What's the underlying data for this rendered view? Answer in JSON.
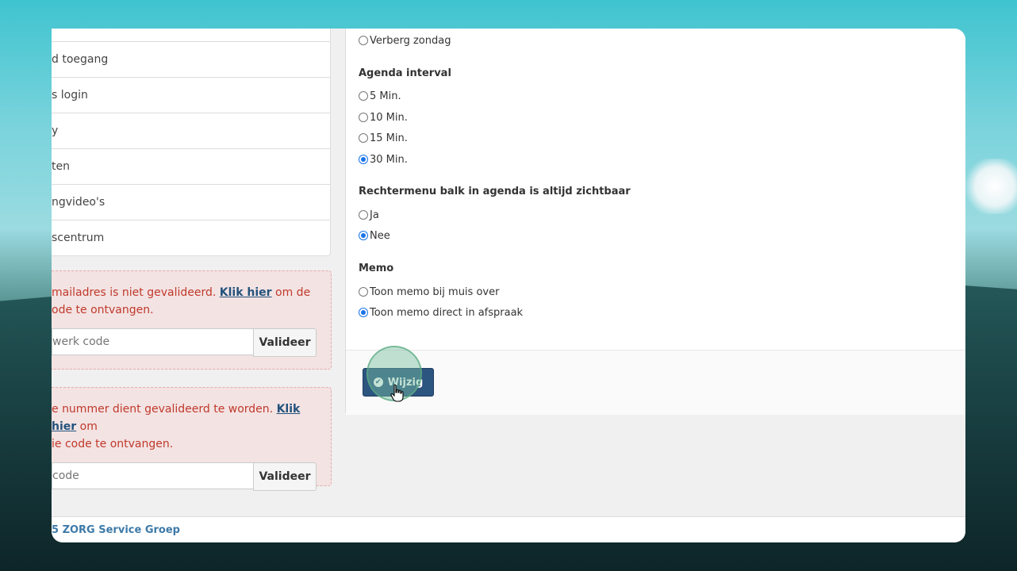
{
  "sidebar": {
    "items": [
      {
        "label": "d toegang"
      },
      {
        "label": "s login"
      },
      {
        "label": "y"
      },
      {
        "label": "ten"
      },
      {
        "label": "ngvideo's"
      },
      {
        "label": "scentrum"
      }
    ]
  },
  "email_alert": {
    "text_before": "mailadres is niet gevalideerd. ",
    "link": "Klik hier",
    "text_after": " om de",
    "line2": "ode te ontvangen.",
    "input_placeholder": "werk code",
    "button": "Valideer"
  },
  "phone_alert": {
    "text_before": "e nummer dient gevalideerd te worden. ",
    "link": "Klik hier",
    "text_after": " om",
    "line2": "ie code te ontvangen.",
    "input_placeholder": "code",
    "button": "Valideer"
  },
  "settings": {
    "hide_sunday": {
      "label": "Verberg zondag",
      "checked": false
    },
    "interval": {
      "heading": "Agenda interval",
      "options": [
        {
          "label": "5 Min.",
          "checked": false
        },
        {
          "label": "10 Min.",
          "checked": false
        },
        {
          "label": "15 Min.",
          "checked": false
        },
        {
          "label": "30 Min.",
          "checked": true
        }
      ]
    },
    "right_menu": {
      "heading": "Rechtermenu balk in agenda is altijd zichtbaar",
      "options": [
        {
          "label": "Ja",
          "checked": false
        },
        {
          "label": "Nee",
          "checked": true
        }
      ]
    },
    "memo": {
      "heading": "Memo",
      "options": [
        {
          "label": "Toon memo bij muis over",
          "checked": false
        },
        {
          "label": "Toon memo direct in afspraak",
          "checked": true
        }
      ]
    }
  },
  "save_button": {
    "label": "Wijzig",
    "icon": "check-circle-icon"
  },
  "footer": {
    "text": "5 ZORG Service Groep"
  },
  "colors": {
    "primary_button": "#2c5580",
    "alert_text": "#c0392b",
    "link": "#23527c",
    "radio_checked": "#1a73e8"
  }
}
